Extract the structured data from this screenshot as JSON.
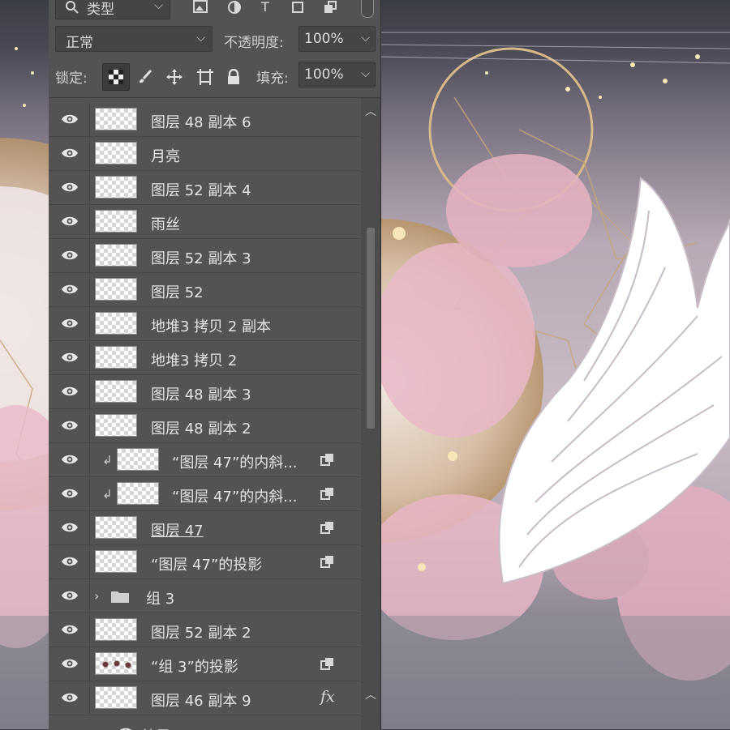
{
  "filter": {
    "kind_label": "类型"
  },
  "blend": {
    "mode": "正常",
    "opacity_label": "不透明度:",
    "opacity_value": "100%"
  },
  "lock": {
    "label": "锁定:",
    "fill_label": "填充:",
    "fill_value": "100%"
  },
  "layers": [
    {
      "name": "图层 48 副本 6"
    },
    {
      "name": "月亮"
    },
    {
      "name": "图层 52 副本 4"
    },
    {
      "name": "雨丝"
    },
    {
      "name": "图层 52 副本 3"
    },
    {
      "name": "图层 52"
    },
    {
      "name": "地堆3 拷贝 2 副本"
    },
    {
      "name": "地堆3 拷贝 2"
    },
    {
      "name": "图层 48 副本 3"
    },
    {
      "name": "图层 48 副本 2"
    },
    {
      "name": "“图层 47”的内斜..."
    },
    {
      "name": "“图层 47”的内斜..."
    },
    {
      "name": "图层 47"
    },
    {
      "name": "“图层 47”的投影"
    },
    {
      "name": "组 3"
    },
    {
      "name": "图层 52 副本 2"
    },
    {
      "name": "“组 3”的投影"
    },
    {
      "name": "图层 46 副本 9",
      "fx": "fx"
    }
  ],
  "effects_label": "效果",
  "colors": {
    "panel_bg": "#535353",
    "field_bg": "#454545",
    "text": "#e4e4e4"
  },
  "icons": [
    "search-icon",
    "image-filter-icon",
    "adjustment-filter-icon",
    "type-filter-icon",
    "shape-filter-icon",
    "smart-object-filter-icon",
    "eye-icon",
    "lock-icon",
    "brush-icon",
    "move-icon",
    "artboard-icon",
    "checker-icon",
    "folder-icon",
    "link-icon"
  ]
}
